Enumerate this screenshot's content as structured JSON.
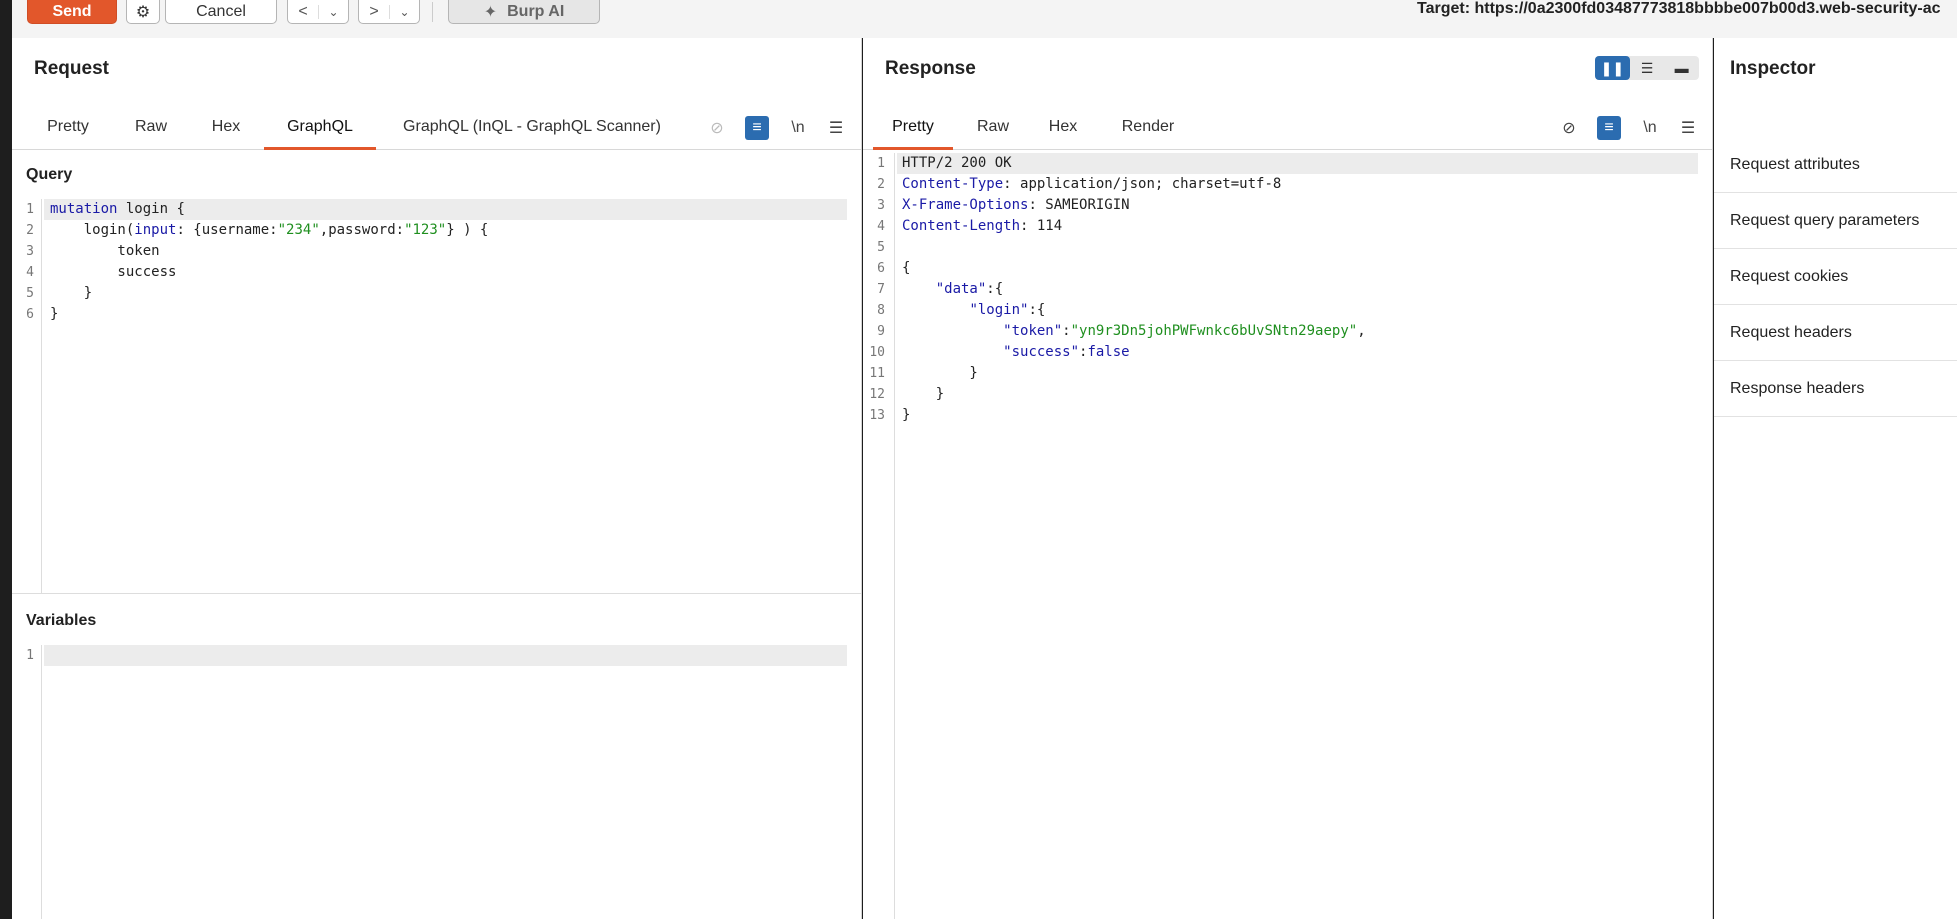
{
  "toolbar": {
    "send_label": "Send",
    "cancel_label": "Cancel",
    "back_glyph": "<",
    "fwd_glyph": ">",
    "dropdown_glyph": "⌄",
    "burpai_label": "Burp AI",
    "target": "Target: https://0a2300fd03487773818bbbbe007b00d3.web-security-ac"
  },
  "request": {
    "title": "Request",
    "tabs": [
      "Pretty",
      "Raw",
      "Hex",
      "GraphQL",
      "GraphQL (InQL - GraphQL Scanner)"
    ],
    "active_tab": "GraphQL",
    "query_label": "Query",
    "variables_label": "Variables",
    "newline_label": "\\n",
    "query_lines": [
      "mutation login {",
      "    login(input: {username:\"234\",password:\"123\"} ) {",
      "        token",
      "        success",
      "    }",
      "}"
    ],
    "variables_lines": [
      ""
    ]
  },
  "response": {
    "title": "Response",
    "tabs": [
      "Pretty",
      "Raw",
      "Hex",
      "Render"
    ],
    "active_tab": "Pretty",
    "newline_label": "\\n",
    "lines": [
      "HTTP/2 200 OK",
      "Content-Type: application/json; charset=utf-8",
      "X-Frame-Options: SAMEORIGIN",
      "Content-Length: 114",
      "",
      "{",
      "    \"data\":{",
      "        \"login\":{",
      "            \"token\":\"yn9r3Dn5johPWFwnkc6bUvSNtn29aepy\",",
      "            \"success\":false",
      "        }",
      "    }",
      "}"
    ]
  },
  "inspector": {
    "title": "Inspector",
    "items": [
      "Request attributes",
      "Request query parameters",
      "Request cookies",
      "Request headers",
      "Response headers"
    ]
  },
  "colors": {
    "accent": "#e2572b",
    "blue": "#2b6cb0"
  }
}
